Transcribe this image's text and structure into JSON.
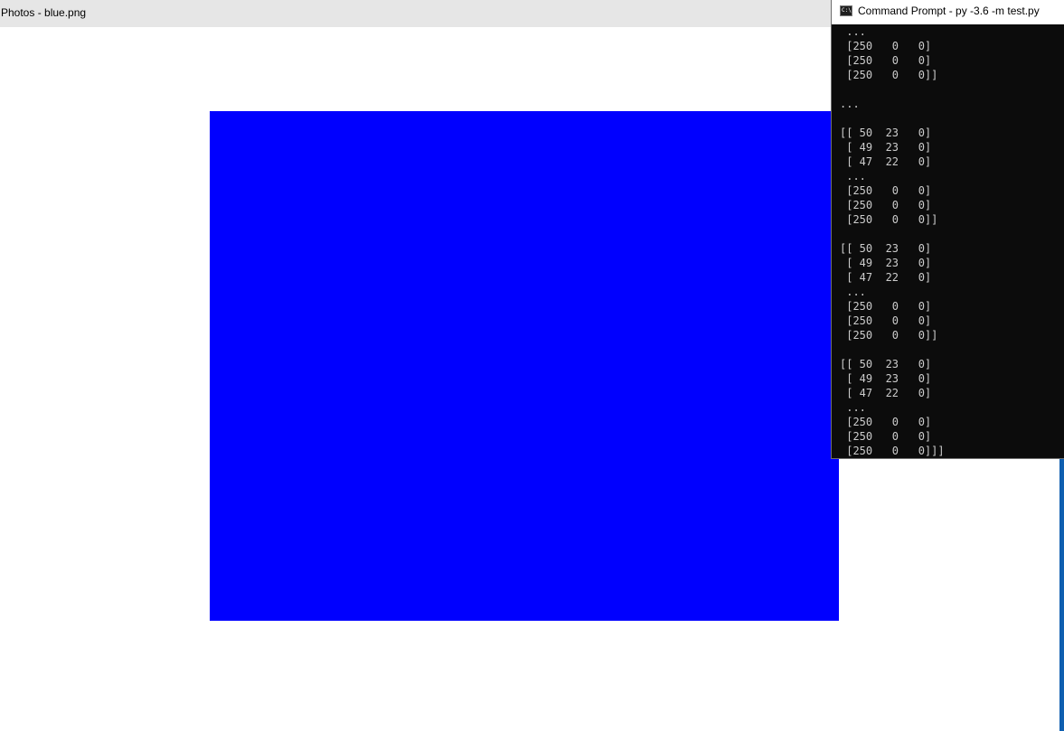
{
  "photos": {
    "title": "Photos - blue.png",
    "image_color": "#0000ff",
    "titlebar_color": "#e6e6e6"
  },
  "desktop": {
    "accent_color": "#0f5fb0"
  },
  "cmd": {
    "title": "Command Prompt - py  -3.6 -m test.py",
    "icon": "cmd-icon",
    "icon_glyph": "C:\\",
    "background_color": "#0c0c0c",
    "text_color": "#cccccc",
    "lines": [
      " ...",
      " [250   0   0]",
      " [250   0   0]",
      " [250   0   0]]",
      "",
      "...",
      "",
      "[[ 50  23   0]",
      " [ 49  23   0]",
      " [ 47  22   0]",
      " ...",
      " [250   0   0]",
      " [250   0   0]",
      " [250   0   0]]",
      "",
      "[[ 50  23   0]",
      " [ 49  23   0]",
      " [ 47  22   0]",
      " ...",
      " [250   0   0]",
      " [250   0   0]",
      " [250   0   0]]",
      "",
      "[[ 50  23   0]",
      " [ 49  23   0]",
      " [ 47  22   0]",
      " ...",
      " [250   0   0]",
      " [250   0   0]",
      " [250   0   0]]]"
    ]
  }
}
